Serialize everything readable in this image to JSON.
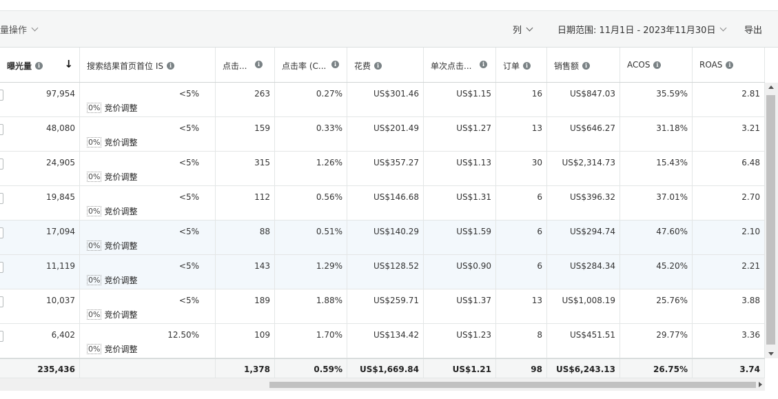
{
  "toolbar": {
    "bulk_label": "量操作",
    "columns_label": "列",
    "date_range_label": "日期范围: 11月1日 - 2023年11月30日",
    "export_label": "导出"
  },
  "columns": [
    {
      "label": "曝光量",
      "bold": true,
      "sorted": true
    },
    {
      "label": "搜索结果首页首位 IS"
    },
    {
      "label": "点击..."
    },
    {
      "label": "点击率 (C..."
    },
    {
      "label": "花费"
    },
    {
      "label": "单次点击..."
    },
    {
      "label": "订单"
    },
    {
      "label": "销售额"
    },
    {
      "label": "ACOS"
    },
    {
      "label": "ROAS"
    }
  ],
  "bid_adjust": {
    "pct": "0%",
    "label": "竞价调整"
  },
  "rows": [
    [
      "97,954",
      "<5%",
      "263",
      "0.27%",
      "US$301.46",
      "US$1.15",
      "16",
      "US$847.03",
      "35.59%",
      "2.81"
    ],
    [
      "48,080",
      "<5%",
      "159",
      "0.33%",
      "US$201.49",
      "US$1.27",
      "13",
      "US$646.27",
      "31.18%",
      "3.21"
    ],
    [
      "24,905",
      "<5%",
      "315",
      "1.26%",
      "US$357.27",
      "US$1.13",
      "30",
      "US$2,314.73",
      "15.43%",
      "6.48"
    ],
    [
      "19,845",
      "<5%",
      "112",
      "0.56%",
      "US$146.68",
      "US$1.31",
      "6",
      "US$396.32",
      "37.01%",
      "2.70"
    ],
    [
      "17,094",
      "<5%",
      "88",
      "0.51%",
      "US$140.29",
      "US$1.59",
      "6",
      "US$294.74",
      "47.60%",
      "2.10"
    ],
    [
      "11,119",
      "<5%",
      "143",
      "1.29%",
      "US$128.52",
      "US$0.90",
      "6",
      "US$284.34",
      "45.20%",
      "2.21"
    ],
    [
      "10,037",
      "<5%",
      "189",
      "1.88%",
      "US$259.71",
      "US$1.37",
      "13",
      "US$1,008.19",
      "25.76%",
      "3.88"
    ],
    [
      "6,402",
      "12.50%",
      "109",
      "1.70%",
      "US$134.42",
      "US$1.23",
      "8",
      "US$451.51",
      "29.77%",
      "3.36"
    ]
  ],
  "totals": [
    "235,436",
    "",
    "1,378",
    "0.59%",
    "US$1,669.84",
    "US$1.21",
    "98",
    "US$6,243.13",
    "26.75%",
    "3.74"
  ],
  "colors": {
    "highlight_row": "#f3f8fc",
    "total_bg": "#f5f6f6",
    "toolbar_bg": "#f5f6f6"
  }
}
